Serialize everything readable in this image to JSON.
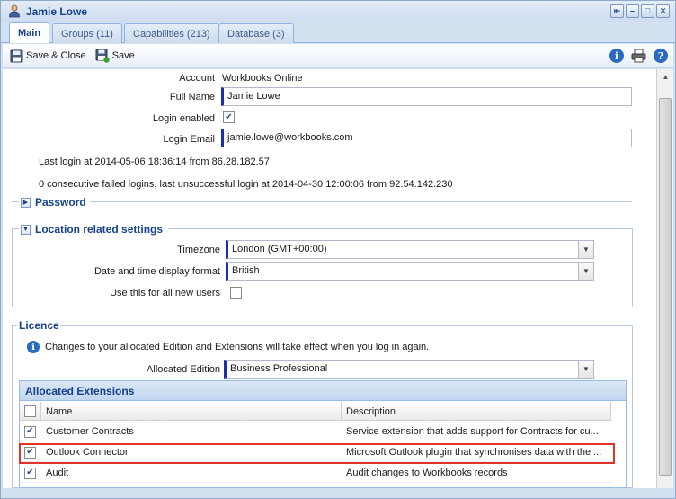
{
  "window": {
    "title": "Jamie Lowe"
  },
  "tabs": [
    {
      "label": "Main"
    },
    {
      "label": "Groups (11)"
    },
    {
      "label": "Capabilities (213)"
    },
    {
      "label": "Database (3)"
    }
  ],
  "toolbar": {
    "save_close_label": "Save & Close",
    "save_label": "Save"
  },
  "form": {
    "account_label": "Account",
    "account_value": "Workbooks Online",
    "full_name_label": "Full Name",
    "full_name_value": "Jamie Lowe",
    "login_enabled_label": "Login enabled",
    "login_enabled_checked": true,
    "login_email_label": "Login Email",
    "login_email_value": "jamie.lowe@workbooks.com",
    "last_login_text": "Last login at 2014-05-06 18:36:14 from 86.28.182.57",
    "failed_logins_text": "0 consecutive failed logins, last unsuccessful login at 2014-04-30 12:00:06 from 92.54.142.230"
  },
  "password_section": {
    "title": "Password"
  },
  "location_section": {
    "title": "Location related settings",
    "timezone_label": "Timezone",
    "timezone_value": "London (GMT+00:00)",
    "date_format_label": "Date and time display format",
    "date_format_value": "British",
    "use_for_new_label": "Use this for all new users",
    "use_for_new_checked": false
  },
  "licence_section": {
    "title": "Licence",
    "info_text": "Changes to your allocated Edition and Extensions will take effect when you log in again.",
    "edition_label": "Allocated Edition",
    "edition_value": "Business Professional"
  },
  "extensions_grid": {
    "title": "Allocated Extensions",
    "columns": {
      "name": "Name",
      "description": "Description"
    },
    "rows": [
      {
        "checked": true,
        "name": "Customer Contracts",
        "description": "Service extension that adds support for Contracts for cu..."
      },
      {
        "checked": true,
        "name": "Outlook Connector",
        "description": "Microsoft Outlook plugin that synchronises data with the ..."
      },
      {
        "checked": true,
        "name": "Audit",
        "description": "Audit changes to Workbooks records"
      }
    ]
  },
  "colors": {
    "accent": "#15428b",
    "highlight": "#e0342b",
    "required_bar": "#1a2fb0"
  }
}
